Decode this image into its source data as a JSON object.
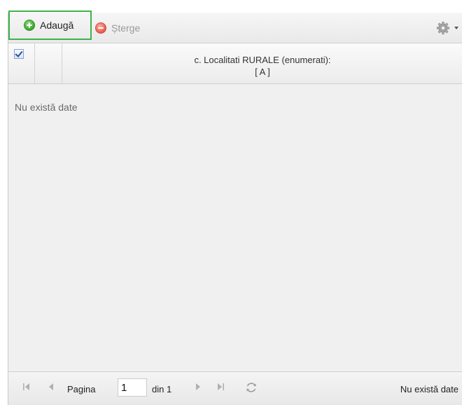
{
  "toolbar": {
    "add_label": "Adaugă",
    "delete_label": "Șterge"
  },
  "grid": {
    "column_title_line1": "c. Localitati RURALE (enumerati):",
    "column_title_line2": "[ A ]",
    "empty_message": "Nu există date",
    "select_all_checked": true
  },
  "pager": {
    "page_label": "Pagina",
    "page_value": "1",
    "of_label": "din 1",
    "status": "Nu există date"
  },
  "colors": {
    "highlight_border": "#3db34a",
    "add_icon": "#3aa62c",
    "delete_icon": "#e85a4c"
  },
  "icons": [
    "add-icon",
    "delete-icon",
    "gear-icon",
    "first-page-icon",
    "prev-page-icon",
    "next-page-icon",
    "last-page-icon",
    "refresh-icon"
  ]
}
